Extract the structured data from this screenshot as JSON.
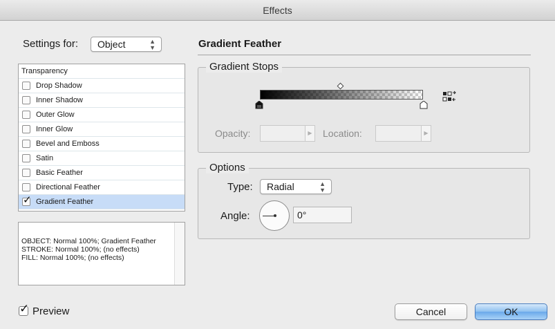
{
  "window": {
    "title": "Effects"
  },
  "settings": {
    "label": "Settings for:",
    "selected": "Object"
  },
  "effects_list": {
    "header": "Transparency",
    "items": [
      {
        "label": "Drop Shadow",
        "checked": false
      },
      {
        "label": "Inner Shadow",
        "checked": false
      },
      {
        "label": "Outer Glow",
        "checked": false
      },
      {
        "label": "Inner Glow",
        "checked": false
      },
      {
        "label": "Bevel and Emboss",
        "checked": false
      },
      {
        "label": "Satin",
        "checked": false
      },
      {
        "label": "Basic Feather",
        "checked": false
      },
      {
        "label": "Directional Feather",
        "checked": false
      },
      {
        "label": "Gradient Feather",
        "checked": true
      }
    ]
  },
  "summary": {
    "lines": [
      "OBJECT: Normal 100%; Gradient Feather",
      "STROKE: Normal 100%; (no effects)",
      "FILL: Normal 100%; (no effects)"
    ]
  },
  "panel": {
    "title": "Gradient Feather"
  },
  "gradient_stops": {
    "title": "Gradient Stops",
    "opacity_label": "Opacity:",
    "opacity_value": "",
    "location_label": "Location:",
    "location_value": ""
  },
  "options": {
    "title": "Options",
    "type_label": "Type:",
    "type_value": "Radial",
    "angle_label": "Angle:",
    "angle_value": "0°"
  },
  "preview": {
    "label": "Preview",
    "checked": true
  },
  "buttons": {
    "cancel": "Cancel",
    "ok": "OK"
  },
  "colors": {
    "selection": "#c7dcf7",
    "default_button": "#6aa9ea"
  }
}
